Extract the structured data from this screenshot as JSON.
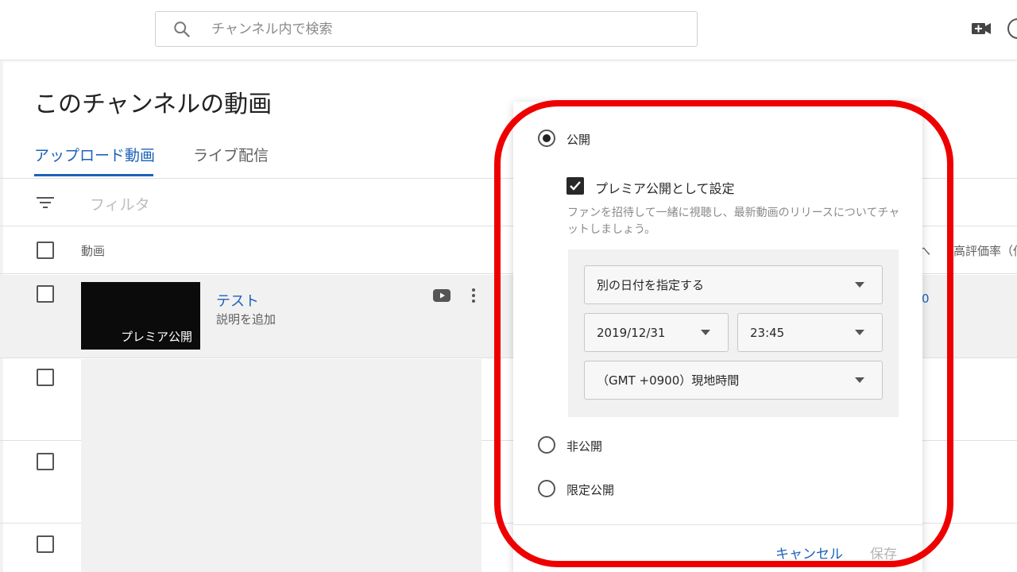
{
  "header": {
    "search_placeholder": "チャンネル内で検索"
  },
  "page": {
    "title": "このチャンネルの動画",
    "tabs": [
      {
        "label": "アップロード動画",
        "active": true
      },
      {
        "label": "ライブ配信",
        "active": false
      }
    ],
    "filter_placeholder": "フィルタ"
  },
  "table": {
    "columns": {
      "video": "動画",
      "right_partial_1": "へ",
      "right_partial_2": "高評価率（低"
    },
    "rows": [
      {
        "thumbnail_label": "プレミア公開",
        "title": "テスト",
        "description": "説明を追加",
        "right_value": "0"
      }
    ]
  },
  "visibility_popup": {
    "options": {
      "public": "公開",
      "private": "非公開",
      "unlisted": "限定公開"
    },
    "selected": "public",
    "premiere": {
      "checked": true,
      "label": "プレミア公開として設定",
      "help": "ファンを招待して一緒に視聴し、最新動画のリリースについてチャットしましょう。"
    },
    "schedule": {
      "date_mode": "別の日付を指定する",
      "date": "2019/12/31",
      "time": "23:45",
      "timezone": "（GMT +0900）現地時間"
    },
    "buttons": {
      "cancel": "キャンセル",
      "save": "保存"
    }
  },
  "colors": {
    "accent": "#1c62b9",
    "highlight_outline": "#ee0000"
  }
}
